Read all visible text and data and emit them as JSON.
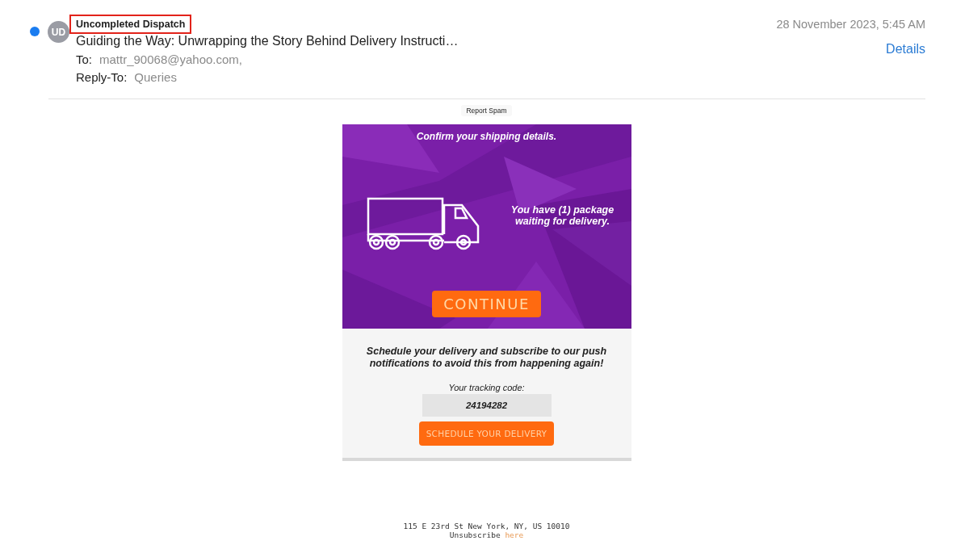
{
  "message": {
    "unread": true,
    "avatar": "UD",
    "sender": "Uncompleted Dispatch",
    "sender_highlighted": true,
    "subject": "Guiding the Way: Unwrapping the Story Behind Delivery Instructi…",
    "to_label": "To:",
    "to": "mattr_90068@yahoo.com,",
    "reply_to_label": "Reply-To:",
    "reply_to": "Queries",
    "date": "28 November 2023, 5:45 AM",
    "details_link": "Details"
  },
  "report_spam": "Report Spam",
  "banner": {
    "heading": "Confirm your shipping details.",
    "package_text": "You have (1) package waiting for delivery.",
    "button": "CONTINUE"
  },
  "body": {
    "text": "Schedule your delivery and subscribe to our push notifications to avoid this from happening again!",
    "tracking_label": "Your tracking code:",
    "tracking_code": "24194282",
    "button": "SCHEDULE YOUR DELIVERY"
  },
  "footer": {
    "address": "115 E 23rd St New York, NY, US 10010",
    "unsubscribe": "Unsubscribe",
    "unsubscribe_link": "here"
  }
}
